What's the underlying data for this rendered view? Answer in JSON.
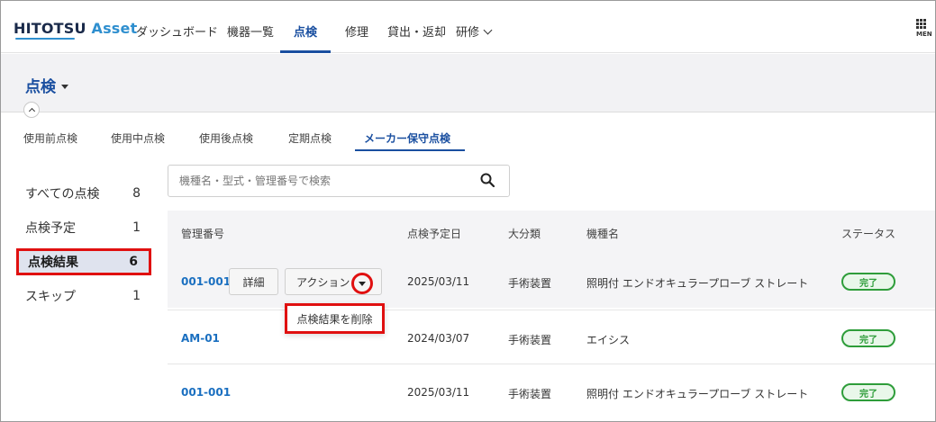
{
  "header": {
    "logo_main": "HITOTSU",
    "logo_accent": "Asset",
    "nav": [
      "ダッシュボード",
      "機器一覧",
      "点検",
      "修理",
      "貸出・返却",
      "研修"
    ],
    "menu_label": "MEN"
  },
  "page": {
    "title": "点検"
  },
  "subtabs": [
    "使用前点検",
    "使用中点検",
    "使用後点検",
    "定期点検",
    "メーカー保守点検"
  ],
  "sidebar": [
    {
      "label": "すべての点検",
      "count": "8"
    },
    {
      "label": "点検予定",
      "count": "1"
    },
    {
      "label": "点検結果",
      "count": "6"
    },
    {
      "label": "スキップ",
      "count": "1"
    }
  ],
  "search": {
    "placeholder": "機種名・型式・管理番号で検索"
  },
  "table": {
    "headers": [
      "管理番号",
      "点検予定日",
      "大分類",
      "機種名",
      "ステータス"
    ],
    "detail_label": "詳細",
    "action_label": "アクション",
    "rows": [
      {
        "id": "001-001",
        "date": "2025/03/11",
        "category": "手術装置",
        "model": "照明付 エンドオキュラープローブ ストレート",
        "status": "完了"
      },
      {
        "id": "AM-01",
        "date": "2024/03/07",
        "category": "手術装置",
        "model": "エイシス",
        "status": "完了"
      },
      {
        "id": "001-001",
        "date": "2025/03/11",
        "category": "手術装置",
        "model": "照明付 エンドオキュラープローブ ストレート",
        "status": "完了"
      }
    ]
  },
  "dropdown": {
    "delete_label": "点検結果を削除"
  },
  "colors": {
    "accent": "#1a4fa0",
    "link": "#1a6fc0",
    "status_green": "#2e9d3a",
    "highlight_red": "#e01010"
  }
}
